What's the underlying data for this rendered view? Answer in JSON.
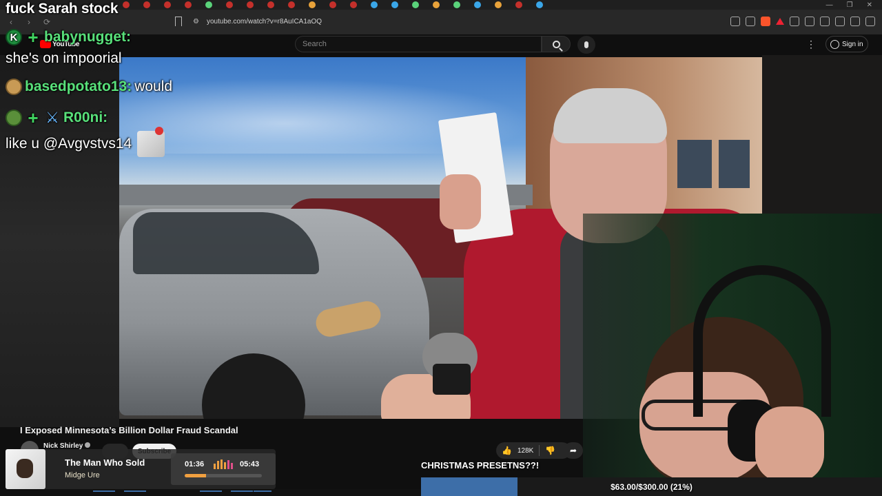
{
  "browser": {
    "url": "youtube.com/watch?v=r8AuICA1aOQ",
    "nav_back": "‹",
    "nav_forward": "›",
    "nav_reload": "⟳",
    "window_controls": [
      "—",
      "❐",
      "✕"
    ]
  },
  "youtube": {
    "logo_text": "YouTube",
    "search_placeholder": "Search",
    "signin_label": "Sign in",
    "kebab": "⋮",
    "video_title": "I Exposed Minnesota’s Billion Dollar Fraud Scandal",
    "channel_name": "Nick Shirley",
    "subscribe_label": "Subscribe",
    "like_count": "128K",
    "like_icon": "👍",
    "dislike_icon": "👎",
    "share_icon": "➦"
  },
  "chat": {
    "title": "fuck Sarah stock",
    "messages": [
      {
        "badges": [
          "K",
          "+"
        ],
        "user": "babynugget:",
        "text": ""
      },
      {
        "badges": [],
        "user": "",
        "text": "she's on impoorial"
      },
      {
        "badges": [
          "potato"
        ],
        "user": "basedpotato13:",
        "text": "would"
      },
      {
        "badges": [
          "pepe",
          "+",
          "sword"
        ],
        "user": "R00ni:",
        "text": ""
      },
      {
        "badges": [],
        "user": "",
        "text": "like u @Avgvstvs14"
      }
    ]
  },
  "now_playing": {
    "title": "The Man Who Sold",
    "artist": "Midge Ure",
    "elapsed": "01:36",
    "total": "05:43",
    "progress": 0.28
  },
  "goal": {
    "label": "CHRISTMAS PRESETNS??!",
    "text": "$63.00/$300.00 (21%)",
    "fraction": 0.21
  },
  "colors": {
    "chat_name": "#58e07a",
    "goal_fill": "#3d6ea8",
    "yt_red": "#ff0000"
  }
}
